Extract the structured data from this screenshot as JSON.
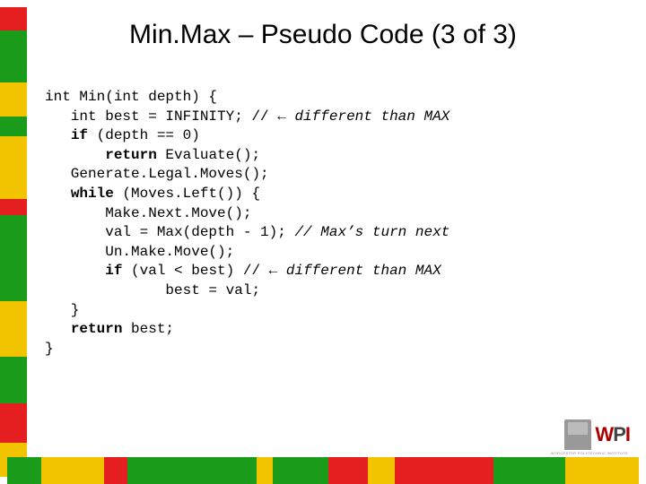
{
  "title": "Min.Max – Pseudo Code (3 of 3)",
  "code": {
    "l1a": "int Min(int depth) {",
    "l2a": "   int best = INFINITY; // ",
    "l2b": "← different than MAX",
    "l3a": "   ",
    "l3b": "if",
    "l3c": " (depth == 0)",
    "l4a": "       ",
    "l4b": "return",
    "l4c": " Evaluate();",
    "l5a": "   Generate.Legal.Moves();",
    "l6a": "   ",
    "l6b": "while",
    "l6c": " (Moves.Left()) {",
    "l7a": "       Make.Next.Move();",
    "l8a": "       val = Max(depth - 1); ",
    "l8b": "// Max’s turn next",
    "l9a": "       Un.Make.Move();",
    "l10a": "       ",
    "l10b": "if",
    "l10c": " (val < best) // ",
    "l10d": "← different than MAX",
    "l11a": "              best = val;",
    "l12a": "   }",
    "l13a": "   ",
    "l13b": "return",
    "l13c": " best;",
    "l14a": "}"
  },
  "logo": {
    "w": "W",
    "p": "P",
    "i": "I",
    "sub": "WORCESTER POLYTECHNIC INSTITUTE"
  },
  "stripes": {
    "colors": [
      "#e51f1f",
      "#1a9b1a",
      "#f2c400",
      "#1a9b1a",
      "#f2c400",
      "#e51f1f",
      "#1a9b1a",
      "#1a9b1a",
      "#f2c400",
      "#1a9b1a",
      "#e51f1f",
      "#f2c400"
    ],
    "left_heights": [
      26,
      58,
      38,
      22,
      70,
      18,
      84,
      12,
      62,
      52,
      44,
      38
    ],
    "bottom_widths": [
      38,
      70,
      26,
      54,
      90,
      18,
      62,
      44,
      30,
      110,
      80,
      82
    ]
  }
}
